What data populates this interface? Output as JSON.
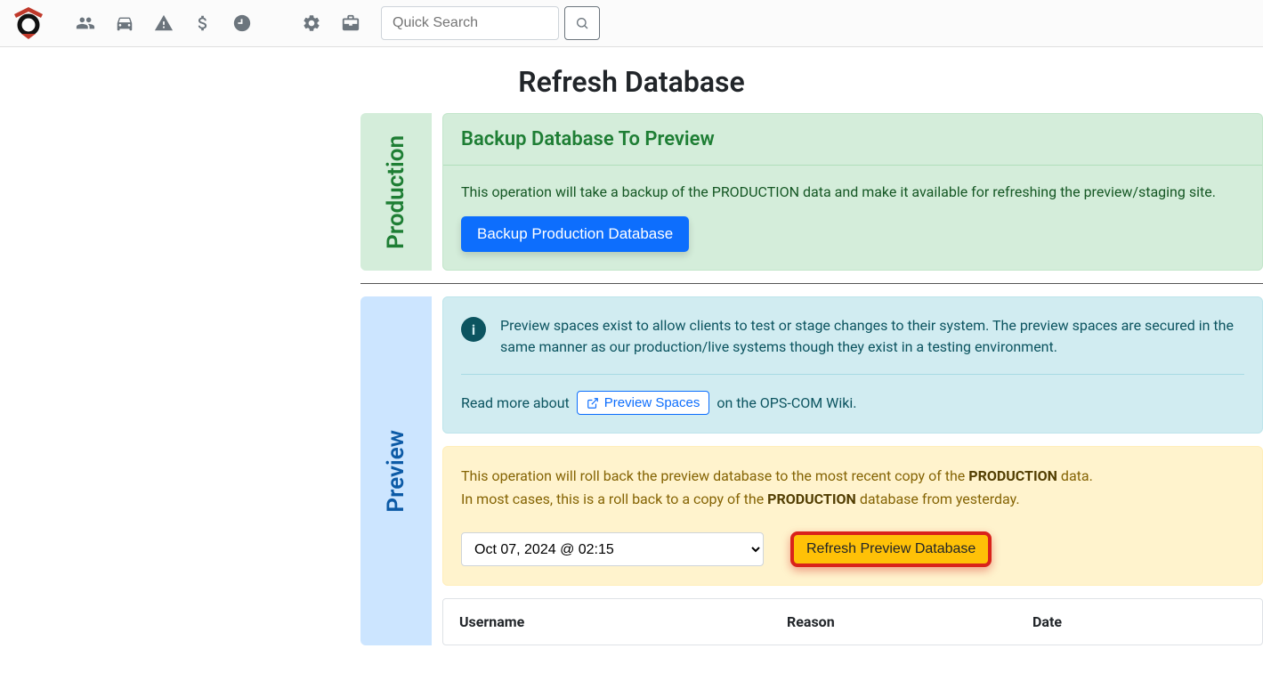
{
  "nav": {
    "search_placeholder": "Quick Search"
  },
  "page": {
    "title": "Refresh Database"
  },
  "production": {
    "label": "Production",
    "header": "Backup Database To Preview",
    "desc": "This operation will take a backup of the PRODUCTION data and make it available for refreshing the preview/staging site.",
    "button": "Backup Production Database"
  },
  "preview": {
    "label": "Preview",
    "info_text": "Preview spaces exist to allow clients to test or stage changes to their system. The preview spaces are secured in the same manner as our production/live systems though they exist in a testing environment.",
    "readmore_prefix": "Read more about",
    "readmore_link": "Preview Spaces",
    "readmore_suffix": "on the OPS-COM Wiki.",
    "yellow_line1_a": "This operation will roll back the preview database to the most recent copy of the ",
    "yellow_line1_b": "PRODUCTION",
    "yellow_line1_c": " data.",
    "yellow_line2_a": "In most cases, this is a roll back to a copy of the ",
    "yellow_line2_b": "PRODUCTION",
    "yellow_line2_c": " database from yesterday.",
    "date_option": "Oct 07, 2024 @ 02:15",
    "refresh_button": "Refresh Preview Database",
    "table": {
      "col1": "Username",
      "col2": "Reason",
      "col3": "Date"
    }
  }
}
